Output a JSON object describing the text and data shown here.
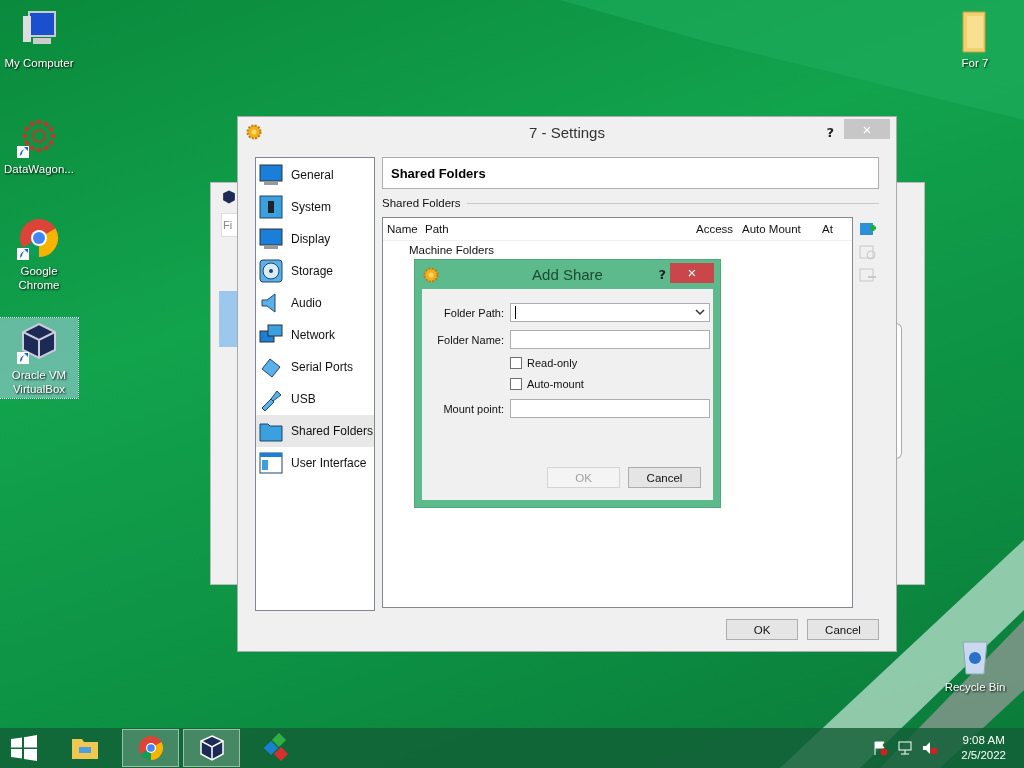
{
  "desktop_icons": [
    {
      "label": "My Computer",
      "kind": "computer",
      "shortcut": false,
      "selected": false
    },
    {
      "label": "DataWagon...",
      "kind": "burst",
      "shortcut": true,
      "selected": false
    },
    {
      "label": "Google Chrome",
      "kind": "browser",
      "shortcut": true,
      "selected": false
    },
    {
      "label": "Oracle VM VirtualBox",
      "kind": "cube",
      "shortcut": true,
      "selected": true
    },
    {
      "label": "For 7",
      "kind": "folder",
      "shortcut": false,
      "selected": false
    },
    {
      "label": "Recycle Bin",
      "kind": "bin",
      "shortcut": false,
      "selected": false
    }
  ],
  "background_window": {
    "field_text": "Fi"
  },
  "settings_window": {
    "title": "7 - Settings",
    "help": "?",
    "close": "×",
    "sidebar": [
      {
        "label": "General",
        "kind": "monitor",
        "selected": false
      },
      {
        "label": "System",
        "kind": "chip",
        "selected": false
      },
      {
        "label": "Display",
        "kind": "monitor",
        "selected": false
      },
      {
        "label": "Storage",
        "kind": "disc",
        "selected": false
      },
      {
        "label": "Audio",
        "kind": "speaker",
        "selected": false
      },
      {
        "label": "Network",
        "kind": "network",
        "selected": false
      },
      {
        "label": "Serial Ports",
        "kind": "plug",
        "selected": false
      },
      {
        "label": "USB",
        "kind": "usb",
        "selected": false
      },
      {
        "label": "Shared Folders",
        "kind": "folder",
        "selected": true
      },
      {
        "label": "User Interface",
        "kind": "window",
        "selected": false
      }
    ],
    "page_title": "Shared Folders",
    "group_label": "Shared Folders",
    "table": {
      "columns": [
        "Name",
        "Path",
        "Access",
        "Auto Mount",
        "At"
      ],
      "rows": [
        {
          "label": "Machine Folders"
        }
      ]
    },
    "toolbar": [
      {
        "kind": "add",
        "disabled": false
      },
      {
        "kind": "edit",
        "disabled": true
      },
      {
        "kind": "remove",
        "disabled": true
      }
    ],
    "buttons": [
      {
        "label": "OK",
        "disabled": false
      },
      {
        "label": "Cancel",
        "disabled": false
      }
    ]
  },
  "add_share_dialog": {
    "title": "Add Share",
    "help": "?",
    "close": "×",
    "fields": [
      {
        "label": "Folder Path:",
        "kind": "combo"
      },
      {
        "label": "Folder Name:",
        "kind": "text"
      },
      {
        "label": "Read-only",
        "kind": "checkbox",
        "checked": false
      },
      {
        "label": "Auto-mount",
        "kind": "checkbox",
        "checked": false
      },
      {
        "label": "Mount point:",
        "kind": "text"
      }
    ],
    "buttons": [
      {
        "label": "OK",
        "disabled": true
      },
      {
        "label": "Cancel",
        "disabled": false
      }
    ]
  },
  "taskbar": {
    "apps": [
      {
        "kind": "start",
        "active": false
      },
      {
        "kind": "explorer",
        "active": false
      },
      {
        "kind": "browser",
        "active": true
      },
      {
        "kind": "cube",
        "active": true
      },
      {
        "kind": "blocks",
        "active": false
      }
    ],
    "time": "9:08 AM",
    "date": "2/5/2022"
  }
}
